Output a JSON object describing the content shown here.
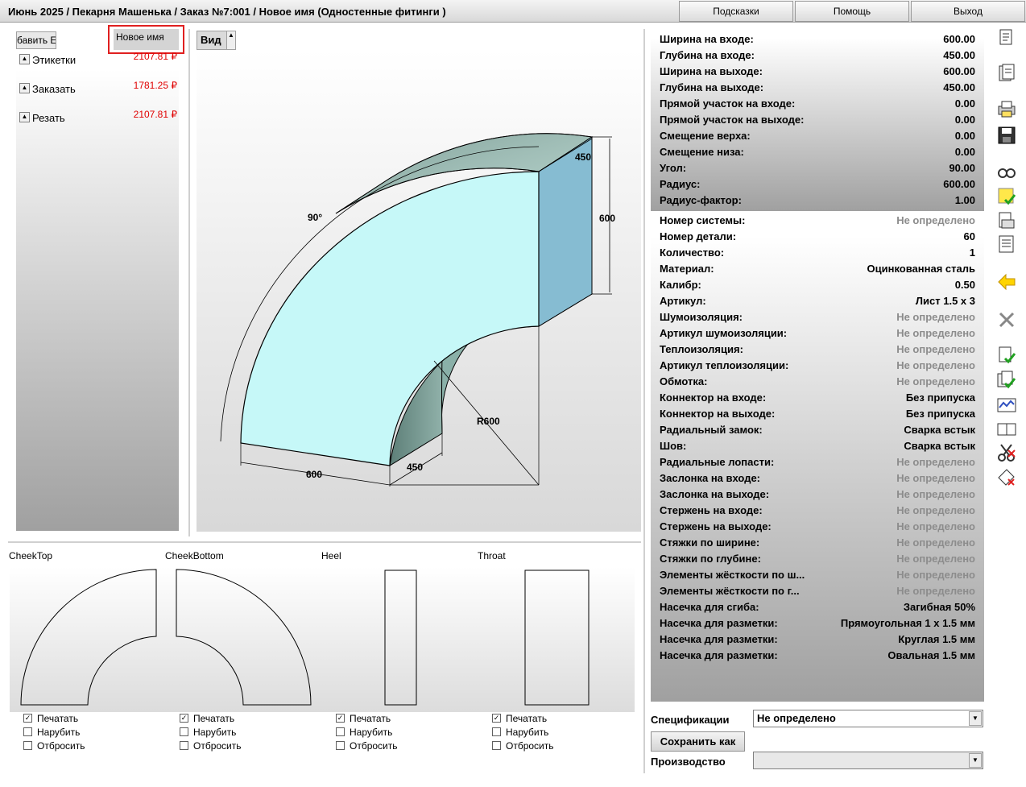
{
  "titlebar": {
    "title": "Июнь 2025 / Пекарня Машенька / Заказ №7:001 / Новое имя (Одностенные фитинги )",
    "hints": "Подсказки",
    "help": "Помощь",
    "exit": "Выход"
  },
  "left": {
    "add_label": "бавить Е",
    "name_tab": "Новое имя",
    "items": [
      {
        "label": "Этикетки",
        "price": "2107.81 ₽"
      },
      {
        "label": "Заказать",
        "price": "1781.25 ₽"
      },
      {
        "label": "Резать",
        "price": "2107.81 ₽"
      }
    ]
  },
  "view": {
    "label": "Вид",
    "dims": {
      "width_top": "450",
      "height_right": "600",
      "angle": "90°",
      "radius": "R600",
      "bottom_width": "600",
      "bottom_depth": "450"
    }
  },
  "patterns": [
    {
      "name": "CheekTop",
      "print": "Печатать",
      "cut": "Нарубить",
      "discard": "Отбросить"
    },
    {
      "name": "CheekBottom",
      "print": "Печатать",
      "cut": "Нарубить",
      "discard": "Отбросить"
    },
    {
      "name": "Heel",
      "print": "Печатать",
      "cut": "Нарубить",
      "discard": "Отбросить"
    },
    {
      "name": "Throat",
      "print": "Печатать",
      "cut": "Нарубить",
      "discard": "Отбросить"
    }
  ],
  "checks": {
    "print": true,
    "cut": false,
    "discard": false
  },
  "dimensions": [
    {
      "key": "Ширина на входе:",
      "value": "600.00"
    },
    {
      "key": "Глубина на входе:",
      "value": "450.00"
    },
    {
      "key": "Ширина на выходе:",
      "value": "600.00"
    },
    {
      "key": "Глубина на выходе:",
      "value": "450.00"
    },
    {
      "key": "Прямой участок на входе:",
      "value": "0.00"
    },
    {
      "key": "Прямой участок на выходе:",
      "value": "0.00"
    },
    {
      "key": "Смещение верха:",
      "value": "0.00"
    },
    {
      "key": "Смещение низа:",
      "value": "0.00"
    },
    {
      "key": "Угол:",
      "value": "90.00"
    },
    {
      "key": "Радиус:",
      "value": "600.00"
    },
    {
      "key": "Радиус-фактор:",
      "value": "1.00"
    }
  ],
  "properties": [
    {
      "key": "Номер системы:",
      "value": "Не определено",
      "undefined": true
    },
    {
      "key": "Номер детали:",
      "value": "60",
      "undefined": false
    },
    {
      "key": "Количество:",
      "value": "1",
      "undefined": false
    },
    {
      "key": "Материал:",
      "value": "Оцинкованная сталь",
      "undefined": false
    },
    {
      "key": "Калибр:",
      "value": "0.50",
      "undefined": false
    },
    {
      "key": "Артикул:",
      "value": "Лист 1.5 x 3",
      "undefined": false
    },
    {
      "key": "Шумоизоляция:",
      "value": "Не определено",
      "undefined": true
    },
    {
      "key": "Артикул шумоизоляции:",
      "value": "Не определено",
      "undefined": true
    },
    {
      "key": "Теплоизоляция:",
      "value": "Не определено",
      "undefined": true
    },
    {
      "key": "Артикул теплоизоляции:",
      "value": "Не определено",
      "undefined": true
    },
    {
      "key": "Обмотка:",
      "value": "Не определено",
      "undefined": true
    },
    {
      "key": "Коннектор на входе:",
      "value": "Без припуска",
      "undefined": false
    },
    {
      "key": "Коннектор на выходе:",
      "value": "Без припуска",
      "undefined": false
    },
    {
      "key": "Радиальный замок:",
      "value": "Сварка встык",
      "undefined": false
    },
    {
      "key": "Шов:",
      "value": "Сварка встык",
      "undefined": false
    },
    {
      "key": "Радиальные лопасти:",
      "value": "Не определено",
      "undefined": true
    },
    {
      "key": "Заслонка на входе:",
      "value": "Не определено",
      "undefined": true
    },
    {
      "key": "Заслонка на выходе:",
      "value": "Не определено",
      "undefined": true
    },
    {
      "key": "Стержень на входе:",
      "value": "Не определено",
      "undefined": true
    },
    {
      "key": "Стержень на выходе:",
      "value": "Не определено",
      "undefined": true
    },
    {
      "key": "Стяжки по ширине:",
      "value": "Не определено",
      "undefined": true
    },
    {
      "key": "Стяжки по глубине:",
      "value": "Не определено",
      "undefined": true
    },
    {
      "key": "Элементы жёсткости по ш...",
      "value": "Не определено",
      "undefined": true
    },
    {
      "key": "Элементы жёсткости по г...",
      "value": "Не определено",
      "undefined": true
    },
    {
      "key": "Насечка для сгиба:",
      "value": "Загибная 50%",
      "undefined": false
    },
    {
      "key": "Насечка для разметки:",
      "value": "Прямоугольная 1 x 1.5 мм",
      "undefined": false
    },
    {
      "key": "Насечка для разметки:",
      "value": "Круглая 1.5 мм",
      "undefined": false
    },
    {
      "key": "Насечка для разметки:",
      "value": "Овальная 1.5 мм",
      "undefined": false
    }
  ],
  "footer": {
    "specs_label": "Спецификации",
    "specs_value": "Не определено",
    "save_label": "Сохранить как",
    "production_label": "Производство",
    "production_value": ""
  },
  "colors": {
    "price": "#e00000",
    "undefined_text": "#8c8c8c",
    "duct_face": "#c6f8f8",
    "duct_side": "#86bcd2",
    "highlight": "#e02020"
  },
  "toolbar_icons": [
    "report-icon",
    "report-list-icon",
    "print-preview-icon",
    "save-icon",
    "glasses-icon",
    "note-check-icon",
    "layout-icon",
    "document-icon",
    "back-arrow-icon",
    "close-x-icon",
    "doc-check-icon",
    "docs-check-icon",
    "chart-icon",
    "book-icon",
    "scissors-icon",
    "eraser-icon"
  ]
}
